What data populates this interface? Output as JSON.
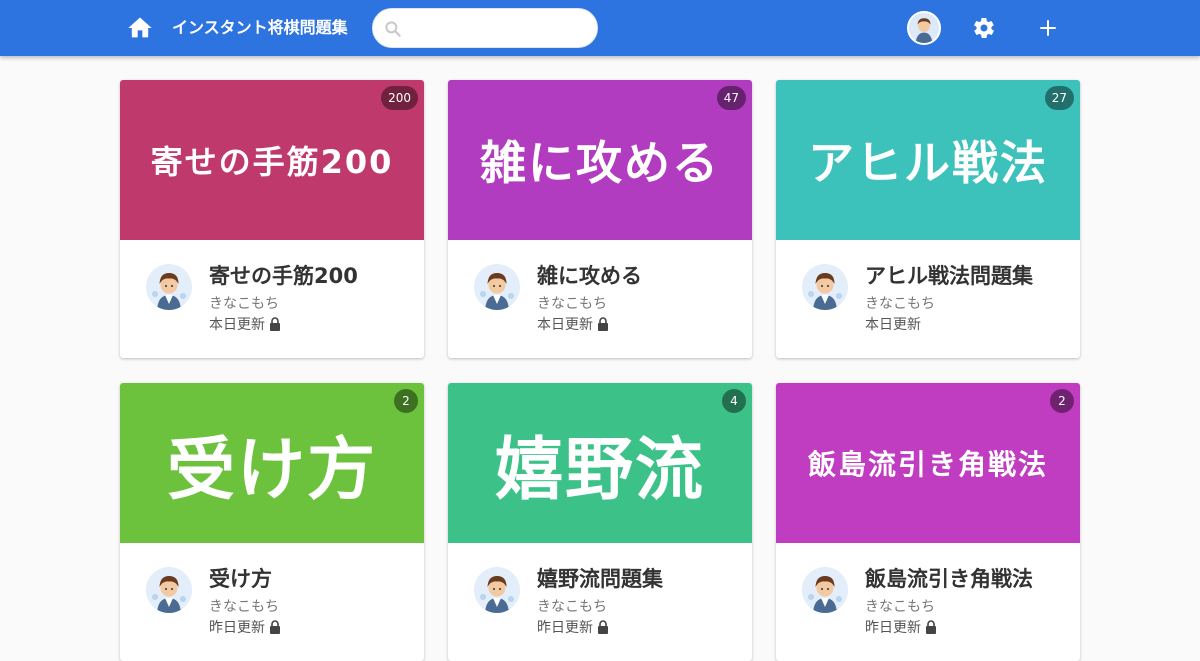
{
  "header": {
    "title": "インスタント将棋問題集",
    "search_placeholder": "",
    "search_value": "",
    "color": "#2e74e0"
  },
  "cards": [
    {
      "cover_text": "寄せの手筋200",
      "count": "200",
      "title": "寄せの手筋200",
      "author": "きなこもち",
      "updated": "本日更新",
      "locked": true,
      "color": "#c0396c"
    },
    {
      "cover_text": "雑に攻める",
      "count": "47",
      "title": "雑に攻める",
      "author": "きなこもち",
      "updated": "本日更新",
      "locked": true,
      "color": "#b23cc0"
    },
    {
      "cover_text": "アヒル戦法",
      "count": "27",
      "title": "アヒル戦法問題集",
      "author": "きなこもち",
      "updated": "本日更新",
      "locked": false,
      "color": "#3cc2ba"
    },
    {
      "cover_text": "受け方",
      "count": "2",
      "title": "受け方",
      "author": "きなこもち",
      "updated": "昨日更新",
      "locked": true,
      "color": "#6cc23c"
    },
    {
      "cover_text": "嬉野流",
      "count": "4",
      "title": "嬉野流問題集",
      "author": "きなこもち",
      "updated": "昨日更新",
      "locked": true,
      "color": "#3cc289"
    },
    {
      "cover_text": "飯島流引き角戦法",
      "count": "2",
      "title": "飯島流引き角戦法",
      "author": "きなこもち",
      "updated": "昨日更新",
      "locked": true,
      "color": "#c03cc0"
    }
  ]
}
